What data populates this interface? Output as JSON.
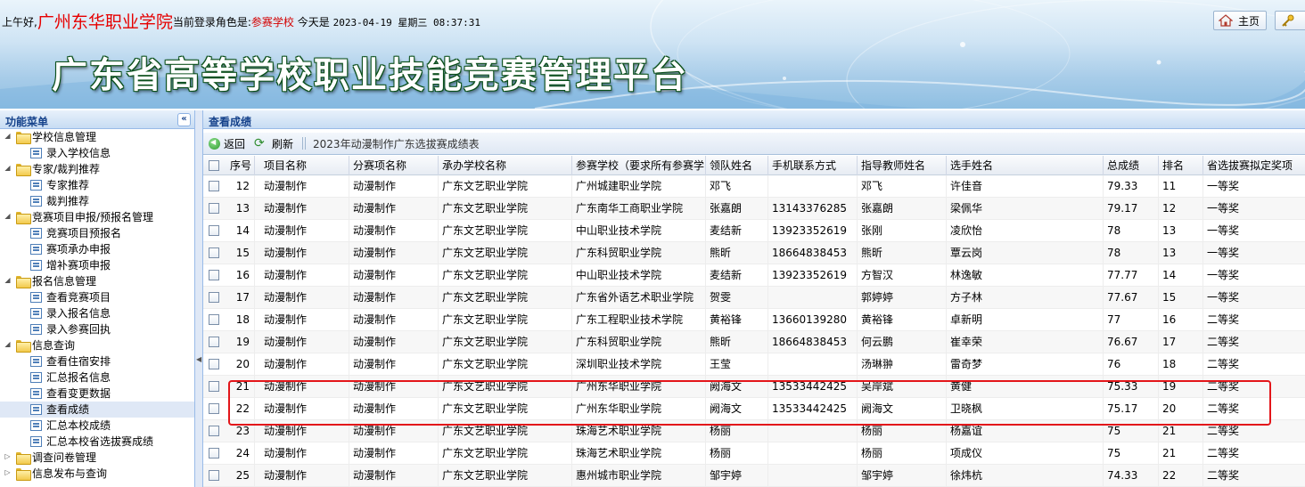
{
  "header": {
    "greeting": "上午好,",
    "school_name": "广州东华职业学院",
    "role_label": "当前登录角色是:",
    "role": "参赛学校",
    "date_label": "今天是",
    "date": "2023-04-19 星期三 08:37:31",
    "platform_title": "广东省高等学校职业技能竞赛管理平台",
    "home_button": "主页"
  },
  "sidebar": {
    "title": "功能菜单",
    "collapse_glyph": "«",
    "items": [
      {
        "label": "学校信息管理",
        "type": "folder",
        "level": 0,
        "expanded": true
      },
      {
        "label": "录入学校信息",
        "type": "leaf",
        "level": 1
      },
      {
        "label": "专家/裁判推荐",
        "type": "folder",
        "level": 0,
        "expanded": true
      },
      {
        "label": "专家推荐",
        "type": "leaf",
        "level": 1
      },
      {
        "label": "裁判推荐",
        "type": "leaf",
        "level": 1
      },
      {
        "label": "竞赛项目申报/预报名管理",
        "type": "folder",
        "level": 0,
        "expanded": true
      },
      {
        "label": "竞赛项目预报名",
        "type": "leaf",
        "level": 1
      },
      {
        "label": "赛项承办申报",
        "type": "leaf",
        "level": 1
      },
      {
        "label": "增补赛项申报",
        "type": "leaf",
        "level": 1
      },
      {
        "label": "报名信息管理",
        "type": "folder",
        "level": 0,
        "expanded": true
      },
      {
        "label": "查看竞赛项目",
        "type": "leaf",
        "level": 1
      },
      {
        "label": "录入报名信息",
        "type": "leaf",
        "level": 1
      },
      {
        "label": "录入参赛回执",
        "type": "leaf",
        "level": 1
      },
      {
        "label": "信息查询",
        "type": "folder",
        "level": 0,
        "expanded": true
      },
      {
        "label": "查看住宿安排",
        "type": "leaf",
        "level": 1
      },
      {
        "label": "汇总报名信息",
        "type": "leaf",
        "level": 1
      },
      {
        "label": "查看变更数据",
        "type": "leaf",
        "level": 1
      },
      {
        "label": "查看成绩",
        "type": "leaf",
        "level": 1,
        "selected": true
      },
      {
        "label": "汇总本校成绩",
        "type": "leaf",
        "level": 1
      },
      {
        "label": "汇总本校省选拔赛成绩",
        "type": "leaf",
        "level": 1
      },
      {
        "label": "调查问卷管理",
        "type": "folder",
        "level": 0,
        "expanded": false
      },
      {
        "label": "信息发布与查询",
        "type": "folder",
        "level": 0,
        "expanded": false
      }
    ]
  },
  "main": {
    "panel_title": "查看成绩",
    "toolbar": {
      "back_label": "返回",
      "refresh_label": "刷新",
      "caption": "2023年动漫制作广东选拔赛成绩表"
    },
    "columns": [
      "序号",
      "项目名称",
      "分赛项名称",
      "承办学校名称",
      "参赛学校（要求所有参赛学",
      "领队姓名",
      "手机联系方式",
      "指导教师姓名",
      "选手姓名",
      "总成绩",
      "排名",
      "省选拔赛拟定奖项"
    ],
    "rows": [
      [
        "12",
        "动漫制作",
        "动漫制作",
        "广东文艺职业学院",
        "广州城建职业学院",
        "邓飞",
        "",
        "邓飞",
        "许佳音",
        "79.33",
        "11",
        "一等奖"
      ],
      [
        "13",
        "动漫制作",
        "动漫制作",
        "广东文艺职业学院",
        "广东南华工商职业学院",
        "张嘉朗",
        "13143376285",
        "张嘉朗",
        "梁佩华",
        "79.17",
        "12",
        "一等奖"
      ],
      [
        "14",
        "动漫制作",
        "动漫制作",
        "广东文艺职业学院",
        "中山职业技术学院",
        "麦结新",
        "13923352619",
        "张刚",
        "凌欣怡",
        "78",
        "13",
        "一等奖"
      ],
      [
        "15",
        "动漫制作",
        "动漫制作",
        "广东文艺职业学院",
        "广东科贸职业学院",
        "熊昕",
        "18664838453",
        "熊昕",
        "覃云岗",
        "78",
        "13",
        "一等奖"
      ],
      [
        "16",
        "动漫制作",
        "动漫制作",
        "广东文艺职业学院",
        "中山职业技术学院",
        "麦结新",
        "13923352619",
        "方智汉",
        "林逸敏",
        "77.77",
        "14",
        "一等奖"
      ],
      [
        "17",
        "动漫制作",
        "动漫制作",
        "广东文艺职业学院",
        "广东省外语艺术职业学院",
        "贺雯",
        "",
        "郭婷婷",
        "方子林",
        "77.67",
        "15",
        "一等奖"
      ],
      [
        "18",
        "动漫制作",
        "动漫制作",
        "广东文艺职业学院",
        "广东工程职业技术学院",
        "黄裕锋",
        "13660139280",
        "黄裕锋",
        "卓新明",
        "77",
        "16",
        "二等奖"
      ],
      [
        "19",
        "动漫制作",
        "动漫制作",
        "广东文艺职业学院",
        "广东科贸职业学院",
        "熊昕",
        "18664838453",
        "何云鹏",
        "崔幸荣",
        "76.67",
        "17",
        "二等奖"
      ],
      [
        "20",
        "动漫制作",
        "动漫制作",
        "广东文艺职业学院",
        "深圳职业技术学院",
        "王莹",
        "",
        "汤琳翀",
        "雷奇梦",
        "76",
        "18",
        "二等奖"
      ],
      [
        "21",
        "动漫制作",
        "动漫制作",
        "广东文艺职业学院",
        "广州东华职业学院",
        "阙海文",
        "13533442425",
        "吴岸斌",
        "黄健",
        "75.33",
        "19",
        "二等奖"
      ],
      [
        "22",
        "动漫制作",
        "动漫制作",
        "广东文艺职业学院",
        "广州东华职业学院",
        "阙海文",
        "13533442425",
        "阙海文",
        "卫晓枫",
        "75.17",
        "20",
        "二等奖"
      ],
      [
        "23",
        "动漫制作",
        "动漫制作",
        "广东文艺职业学院",
        "珠海艺术职业学院",
        "杨丽",
        "",
        "杨丽",
        "杨嘉谊",
        "75",
        "21",
        "二等奖"
      ],
      [
        "24",
        "动漫制作",
        "动漫制作",
        "广东文艺职业学院",
        "珠海艺术职业学院",
        "杨丽",
        "",
        "杨丽",
        "项成仪",
        "75",
        "21",
        "二等奖"
      ],
      [
        "25",
        "动漫制作",
        "动漫制作",
        "广东文艺职业学院",
        "惠州城市职业学院",
        "邹宇婷",
        "",
        "邹宇婷",
        "徐炜杭",
        "74.33",
        "22",
        "二等奖"
      ]
    ],
    "highlighted_rows": [
      "21",
      "22"
    ]
  },
  "colors": {
    "school_name": "#e60000",
    "title_outline": "#0a4f1a",
    "highlight_box": "#e3161a",
    "panel_title": "#15428b"
  }
}
